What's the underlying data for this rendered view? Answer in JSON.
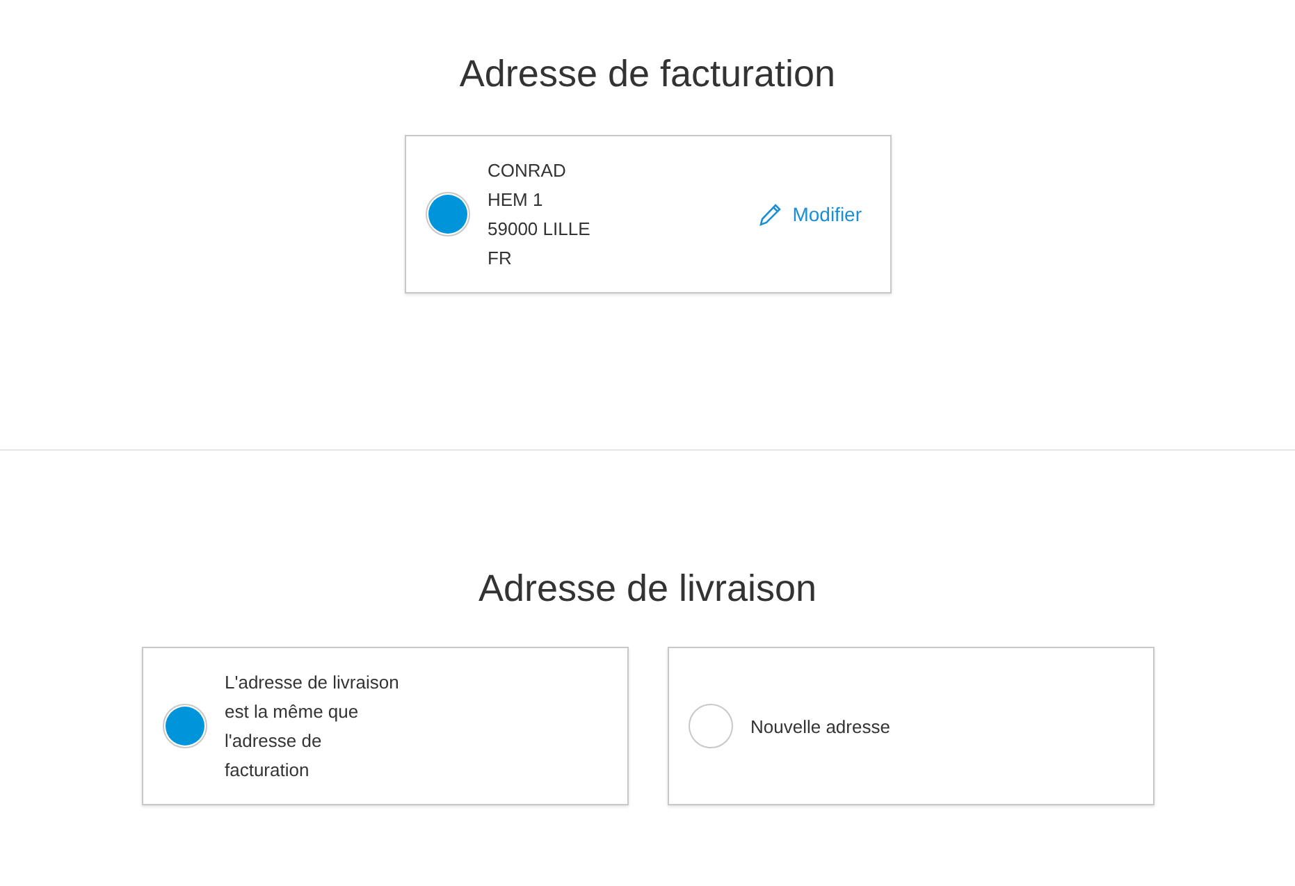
{
  "billing": {
    "title": "Adresse de facturation",
    "selected": true,
    "address_lines": [
      "CONRAD",
      "HEM 1",
      "59000 LILLE",
      "FR"
    ],
    "edit_link": "Modifier"
  },
  "shipping": {
    "title": "Adresse de livraison",
    "options": [
      {
        "label_lines": [
          "L'adresse de livraison",
          "est la même que",
          "l'adresse de",
          "facturation"
        ],
        "selected": true
      },
      {
        "label_lines": [
          "Nouvelle adresse"
        ],
        "selected": false
      }
    ]
  }
}
